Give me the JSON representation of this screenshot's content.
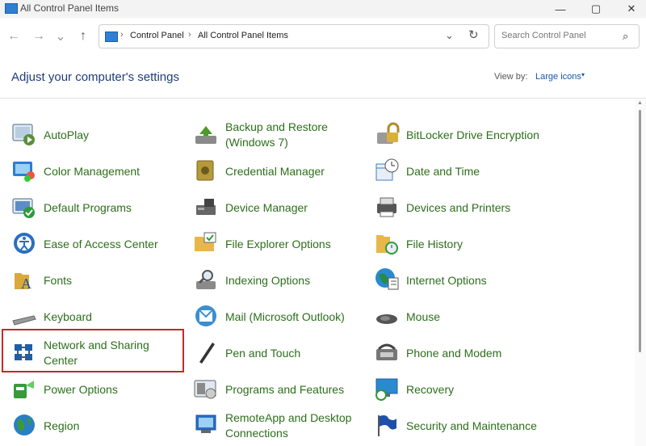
{
  "window": {
    "title": "All Control Panel Items",
    "minimize_icon": "—",
    "maximize_icon": "▢",
    "close_icon": "✕"
  },
  "toolbar": {
    "back_icon": "←",
    "forward_icon": "→",
    "recent_icon": "⌄",
    "up_icon": "↑",
    "breadcrumb": [
      "Control Panel",
      "All Control Panel Items"
    ],
    "sep_icon": "›",
    "dropdown_icon": "⌄",
    "refresh_icon": "↻",
    "search_placeholder": "Search Control Panel",
    "search_icon": "⌕"
  },
  "header": {
    "title": "Adjust your computer's settings",
    "view_by_label": "View by:",
    "view_by_value": "Large icons",
    "caret": "▾"
  },
  "items": [
    {
      "label": "AutoPlay",
      "icon": "autoplay-icon",
      "color": "#5a8f3a"
    },
    {
      "label": "Backup and Restore (Windows 7)",
      "icon": "backup-restore-icon",
      "color": "#4c9a2a"
    },
    {
      "label": "BitLocker Drive Encryption",
      "icon": "bitlocker-icon",
      "color": "#9a9a9a"
    },
    {
      "label": "Color Management",
      "icon": "color-management-icon",
      "color": "#2b7fd0"
    },
    {
      "label": "Credential Manager",
      "icon": "credential-manager-icon",
      "color": "#b59a3a"
    },
    {
      "label": "Date and Time",
      "icon": "date-time-icon",
      "color": "#3b7fc4"
    },
    {
      "label": "Default Programs",
      "icon": "default-programs-icon",
      "color": "#2e9a3a"
    },
    {
      "label": "Device Manager",
      "icon": "device-manager-icon",
      "color": "#666666"
    },
    {
      "label": "Devices and Printers",
      "icon": "devices-printers-icon",
      "color": "#555555"
    },
    {
      "label": "Ease of Access Center",
      "icon": "ease-of-access-icon",
      "color": "#2a6fc0"
    },
    {
      "label": "File Explorer Options",
      "icon": "file-explorer-options-icon",
      "color": "#e8b64a"
    },
    {
      "label": "File History",
      "icon": "file-history-icon",
      "color": "#e8b64a"
    },
    {
      "label": "Fonts",
      "icon": "fonts-icon",
      "color": "#d9a93a"
    },
    {
      "label": "Indexing Options",
      "icon": "indexing-options-icon",
      "color": "#8a8a8a"
    },
    {
      "label": "Internet Options",
      "icon": "internet-options-icon",
      "color": "#2a8a4a"
    },
    {
      "label": "Keyboard",
      "icon": "keyboard-icon",
      "color": "#777777"
    },
    {
      "label": "Mail (Microsoft Outlook)",
      "icon": "mail-icon",
      "color": "#3a8fd0"
    },
    {
      "label": "Mouse",
      "icon": "mouse-icon",
      "color": "#555555"
    },
    {
      "label": "Network and Sharing Center",
      "icon": "network-sharing-icon",
      "color": "#1f5fa8"
    },
    {
      "label": "Pen and Touch",
      "icon": "pen-touch-icon",
      "color": "#333333"
    },
    {
      "label": "Phone and Modem",
      "icon": "phone-modem-icon",
      "color": "#777777"
    },
    {
      "label": "Power Options",
      "icon": "power-options-icon",
      "color": "#3a9a3a"
    },
    {
      "label": "Programs and Features",
      "icon": "programs-features-icon",
      "color": "#8a8a8a"
    },
    {
      "label": "Recovery",
      "icon": "recovery-icon",
      "color": "#2a8ad0"
    },
    {
      "label": "Region",
      "icon": "region-icon",
      "color": "#2a7fc4"
    },
    {
      "label": "RemoteApp and Desktop Connections",
      "icon": "remoteapp-icon",
      "color": "#2a6fc0"
    },
    {
      "label": "Security and Maintenance",
      "icon": "security-maintenance-icon",
      "color": "#1f4fa8"
    }
  ]
}
